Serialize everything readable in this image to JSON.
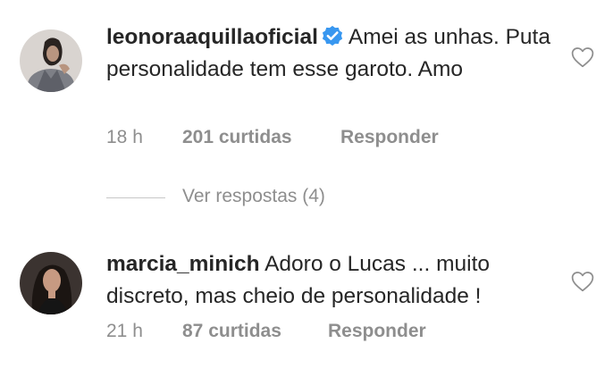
{
  "comments": [
    {
      "username": "leonoraaquillaoficial",
      "verified": true,
      "text": "Amei as unhas. Puta personalidade tem esse garoto. Amo",
      "time": "18 h",
      "likes": "201 curtidas",
      "reply": "Responder",
      "avatar_icon": "avatar-photo-woman-grey-jacket",
      "heart_icon": "heart-outline-icon"
    },
    {
      "username": "marcia_minich",
      "verified": false,
      "text": "Adoro o Lucas ... muito discreto, mas cheio de personalidade !",
      "time": "21 h",
      "likes": "87 curtidas",
      "reply": "Responder",
      "avatar_icon": "avatar-photo-woman-dark-hair",
      "heart_icon": "heart-outline-icon"
    }
  ],
  "view_replies": "Ver respostas (4)",
  "colors": {
    "text": "#262626",
    "secondary": "#8e8e8e",
    "verified_badge": "#3897f0",
    "divider": "#c7c7c7"
  }
}
